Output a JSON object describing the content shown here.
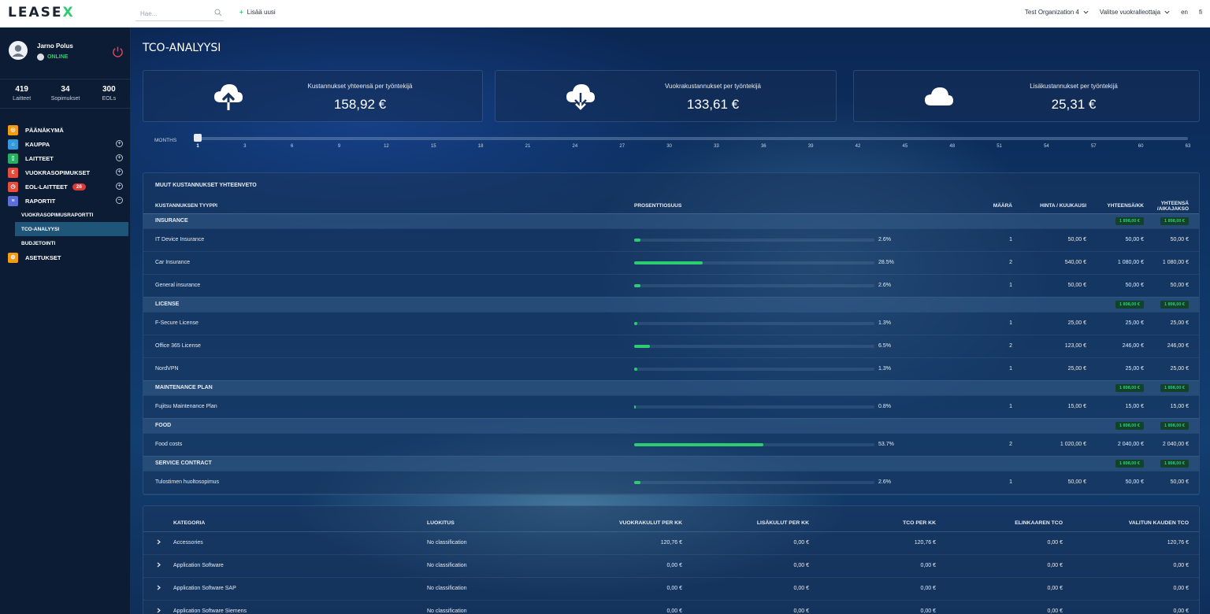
{
  "header": {
    "logo": "LEASE",
    "logo_x": "X",
    "search_placeholder": "Hae...",
    "add_new": "Lisää uusi",
    "organization": "Test Organization 4",
    "lessor_select": "Valitse vuokralleottaja",
    "lang_en": "en",
    "lang_fi": "fi"
  },
  "user": {
    "name": "Jarno Polus",
    "status": "ONLINE"
  },
  "stats": [
    {
      "value": "419",
      "label": "Laitteet"
    },
    {
      "value": "34",
      "label": "Sopimukset"
    },
    {
      "value": "300",
      "label": "EOLs"
    }
  ],
  "nav": {
    "dashboard": "PÄÄNÄKYMÄ",
    "shop": "KAUPPA",
    "devices": "LAITTEET",
    "contracts": "VUOKRASOPIMUKSET",
    "eol": "EOL-LAITTEET",
    "eol_badge": "26",
    "reports": "RAPORTIT",
    "sub_contract_report": "VUOKRASOPIMUSRAPORTTI",
    "sub_tco": "TCO-ANALYYSI",
    "sub_budget": "BUDJETOINTI",
    "settings": "ASETUKSET"
  },
  "colors": {
    "accent": "#2ecc71",
    "dashboard_icon": "#f39c12",
    "shop_icon": "#3498db",
    "devices_icon": "#27ae60",
    "contracts_icon": "#e74c3c",
    "eol_icon": "#e74c3c",
    "reports_icon": "#5b6fd6",
    "settings_icon": "#f39c12"
  },
  "page": {
    "title": "TCO-ANALYYSI"
  },
  "cards": [
    {
      "label": "Kustannukset yhteensä per työntekijä",
      "value": "158,92 €",
      "icon": "cloud-upload-icon"
    },
    {
      "label": "Vuokrakustannukset per työntekijä",
      "value": "133,61 €",
      "icon": "cloud-download-icon"
    },
    {
      "label": "Lisäkustannukset per työntekijä",
      "value": "25,31 €",
      "icon": "cloud-icon"
    }
  ],
  "months": {
    "label": "MONTHS",
    "selected": "1",
    "ticks": [
      "1",
      "3",
      "6",
      "9",
      "12",
      "15",
      "18",
      "21",
      "24",
      "27",
      "30",
      "33",
      "36",
      "39",
      "42",
      "45",
      "48",
      "51",
      "54",
      "57",
      "60",
      "63"
    ]
  },
  "cost_summary": {
    "title": "MUUT KUSTANNUKSET YHTEENVETO",
    "headers": {
      "type": "KUSTANNUKSEN TYYPPI",
      "percent": "PROSENTTIOSUUS",
      "amount": "MÄÄRÄ",
      "price": "HINTA / KUUKAUSI",
      "total_month": "YHTEENSÄ/KK",
      "total_period": "YHTEENSÄ /AIKAJAKSO"
    },
    "groups": [
      {
        "name": "INSURANCE",
        "total_month": "1 898,00 €",
        "total_period": "1 898,00 €",
        "items": [
          {
            "name": "IT Device Insurance",
            "percent": "2.6%",
            "pct": 2.6,
            "amount": "1",
            "price": "50,00 €",
            "total_month": "50,00 €",
            "total_period": "50,00 €"
          },
          {
            "name": "Car Insurance",
            "percent": "28.5%",
            "pct": 28.5,
            "amount": "2",
            "price": "540,00 €",
            "total_month": "1 080,00 €",
            "total_period": "1 080,00 €"
          },
          {
            "name": "General insurance",
            "percent": "2.6%",
            "pct": 2.6,
            "amount": "1",
            "price": "50,00 €",
            "total_month": "50,00 €",
            "total_period": "50,00 €"
          }
        ]
      },
      {
        "name": "LICENSE",
        "total_month": "1 898,00 €",
        "total_period": "1 898,00 €",
        "items": [
          {
            "name": "F-Secure License",
            "percent": "1.3%",
            "pct": 1.3,
            "amount": "1",
            "price": "25,00 €",
            "total_month": "25,00 €",
            "total_period": "25,00 €"
          },
          {
            "name": "Office 365 License",
            "percent": "6.5%",
            "pct": 6.5,
            "amount": "2",
            "price": "123,00 €",
            "total_month": "246,00 €",
            "total_period": "246,00 €"
          },
          {
            "name": "NordVPN",
            "percent": "1.3%",
            "pct": 1.3,
            "amount": "1",
            "price": "25,00 €",
            "total_month": "25,00 €",
            "total_period": "25,00 €"
          }
        ]
      },
      {
        "name": "MAINTENANCE PLAN",
        "total_month": "1 898,00 €",
        "total_period": "1 898,00 €",
        "items": [
          {
            "name": "Fujitsu Maintenance Plan",
            "percent": "0.8%",
            "pct": 0.8,
            "amount": "1",
            "price": "15,00 €",
            "total_month": "15,00 €",
            "total_period": "15,00 €"
          }
        ]
      },
      {
        "name": "FOOD",
        "total_month": "1 898,00 €",
        "total_period": "1 898,00 €",
        "items": [
          {
            "name": "Food costs",
            "percent": "53.7%",
            "pct": 53.7,
            "amount": "2",
            "price": "1 020,00 €",
            "total_month": "2 040,00 €",
            "total_period": "2 040,00 €"
          }
        ]
      },
      {
        "name": "SERVICE CONTRACT",
        "total_month": "1 898,00 €",
        "total_period": "1 898,00 €",
        "items": [
          {
            "name": "Tulostimen huoltosopimus",
            "percent": "2.6%",
            "pct": 2.6,
            "amount": "1",
            "price": "50,00 €",
            "total_month": "50,00 €",
            "total_period": "50,00 €"
          }
        ]
      }
    ]
  },
  "category_table": {
    "headers": {
      "category": "KATEGORIA",
      "classification": "LUOKITUS",
      "lease_cost": "VUOKRAKULUT PER KK",
      "extra_cost": "LISÄKULUT PER KK",
      "tco": "TCO PER KK",
      "lifecycle": "ELINKAAREN TCO",
      "period_tco": "VALITUN KAUDEN TCO"
    },
    "rows": [
      {
        "category": "Accessories",
        "classification": "No classification",
        "lease_cost": "120,76 €",
        "extra_cost": "0,00 €",
        "tco": "120,76 €",
        "lifecycle": "0,00 €",
        "period_tco": "120,76 €"
      },
      {
        "category": "Application Software",
        "classification": "No classification",
        "lease_cost": "0,00 €",
        "extra_cost": "0,00 €",
        "tco": "0,00 €",
        "lifecycle": "0,00 €",
        "period_tco": "0,00 €"
      },
      {
        "category": "Application Software SAP",
        "classification": "No classification",
        "lease_cost": "0,00 €",
        "extra_cost": "0,00 €",
        "tco": "0,00 €",
        "lifecycle": "0,00 €",
        "period_tco": "0,00 €"
      },
      {
        "category": "Application Software Siemens",
        "classification": "No classification",
        "lease_cost": "0,00 €",
        "extra_cost": "0,00 €",
        "tco": "0,00 €",
        "lifecycle": "0,00 €",
        "period_tco": "0,00 €"
      }
    ]
  }
}
